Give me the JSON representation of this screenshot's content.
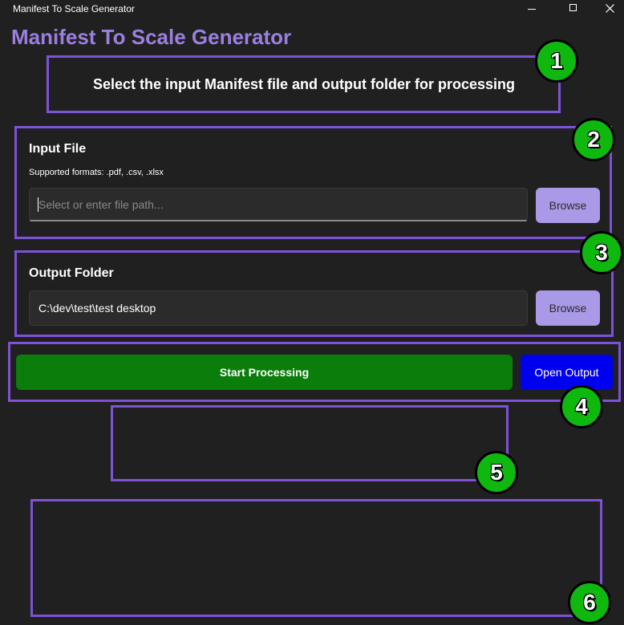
{
  "window": {
    "title": "Manifest To Scale Generator",
    "minimize_icon": "minimize-icon",
    "maximize_icon": "maximize-icon",
    "close_icon": "close-icon"
  },
  "app": {
    "title": "Manifest To Scale Generator",
    "instruction": "Select the input Manifest file and output folder for processing"
  },
  "input_file": {
    "label": "Input File",
    "supported": "Supported formats: .pdf, .csv, .xlsx",
    "value": "",
    "placeholder": "Select or enter file path...",
    "browse_label": "Browse"
  },
  "output_folder": {
    "label": "Output Folder",
    "value": "C:\\dev\\test\\test desktop",
    "browse_label": "Browse"
  },
  "actions": {
    "start_label": "Start Processing",
    "open_label": "Open Output"
  },
  "badges": [
    "1",
    "2",
    "3",
    "4",
    "5",
    "6"
  ],
  "colors": {
    "accent": "#9b7fe0",
    "annotation_border": "#7d52d6",
    "browse_button": "#a999e6",
    "start_button": "#0a7d0a",
    "open_button": "#0000f0",
    "badge": "#0fb80f",
    "background": "#202020"
  }
}
